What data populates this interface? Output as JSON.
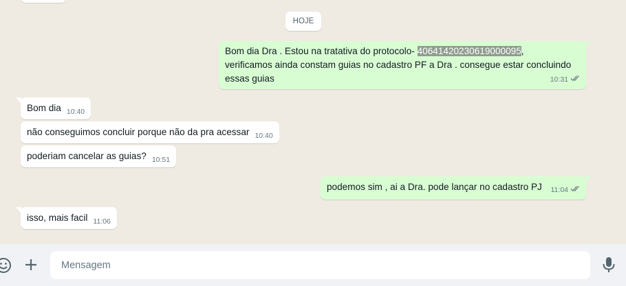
{
  "chat": {
    "date_separator": "HOJE",
    "messages": [
      {
        "text_before": "Bom dia Dra . Estou na tratativa do protocolo- ",
        "highlight": "40641420230619000095",
        "text_after_line1": ",",
        "line2": "verificamos ainda constam guias no cadastro PF a Dra . consegue estar concluindo",
        "line3": "essas guias",
        "time": "10:31"
      },
      {
        "text": "Bom dia",
        "time": "10:40"
      },
      {
        "text": "não conseguimos concluir porque não da pra acessar",
        "time": "10:40"
      },
      {
        "text": "poderiam cancelar as guias?",
        "time": "10:51"
      },
      {
        "text": "podemos sim , ai a Dra. pode lançar no cadastro PJ",
        "time": "11:04"
      },
      {
        "text": "isso, mais facil",
        "time": "11:06"
      }
    ]
  },
  "composer": {
    "placeholder": "Mensagem",
    "emoji_icon": "emoji-icon",
    "attach_icon": "plus-icon",
    "mic_icon": "microphone-icon"
  },
  "colors": {
    "background": "#efeae2",
    "incoming": "#ffffff",
    "outgoing": "#d9fdd3",
    "read_ticks": "#667781"
  }
}
